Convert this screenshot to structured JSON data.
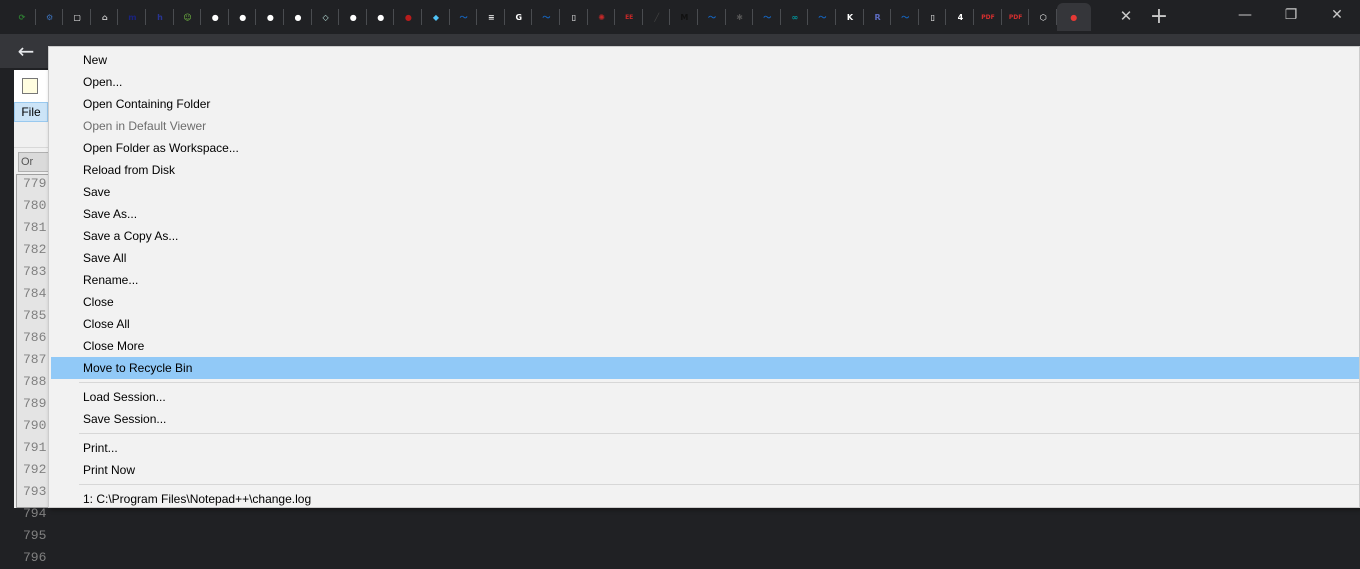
{
  "browser": {
    "tab_favicons": [
      {
        "icon": "globe-refresh-icon",
        "color": "#2e7d32",
        "glyph": "⟳"
      },
      {
        "icon": "python-script-icon",
        "color": "#3b6fb6",
        "glyph": "⚙"
      },
      {
        "icon": "window-square-icon",
        "color": "#ffffff",
        "glyph": "▢"
      },
      {
        "icon": "house-icon",
        "color": "#cfcfcf",
        "glyph": "⌂"
      },
      {
        "icon": "mathworks-icon",
        "color": "#1a237e",
        "glyph": "m"
      },
      {
        "icon": "h-letter-icon",
        "color": "#283593",
        "glyph": "h"
      },
      {
        "icon": "smiley-icon",
        "color": "#76c043",
        "glyph": "☺"
      },
      {
        "icon": "github-icon",
        "color": "#ffffff",
        "glyph": "●"
      },
      {
        "icon": "github-icon",
        "color": "#ffffff",
        "glyph": "●"
      },
      {
        "icon": "github-icon",
        "color": "#ffffff",
        "glyph": "●"
      },
      {
        "icon": "github-icon",
        "color": "#ffffff",
        "glyph": "●"
      },
      {
        "icon": "bulb-icon",
        "color": "#bfe6e0",
        "glyph": "◇"
      },
      {
        "icon": "github-icon",
        "color": "#ffffff",
        "glyph": "●"
      },
      {
        "icon": "github-icon",
        "color": "#ffffff",
        "glyph": "●"
      },
      {
        "icon": "bomb-icon",
        "color": "#b71c1c",
        "glyph": "●"
      },
      {
        "icon": "diagram-icon",
        "color": "#4fc3f7",
        "glyph": "◆"
      },
      {
        "icon": "feather-icon",
        "color": "#1565c0",
        "glyph": "〜"
      },
      {
        "icon": "script-icon",
        "color": "#e0e0e0",
        "glyph": "≡"
      },
      {
        "icon": "google-icon",
        "color": "#ffffff",
        "glyph": "G"
      },
      {
        "icon": "feather-icon",
        "color": "#1565c0",
        "glyph": "〜"
      },
      {
        "icon": "document-icon",
        "color": "#ffffff",
        "glyph": "▯"
      },
      {
        "icon": "compass-icon",
        "color": "#c62828",
        "glyph": "✺"
      },
      {
        "icon": "ee-459-icon",
        "color": "#c62828",
        "glyph": "EE"
      },
      {
        "icon": "chart-dark-icon",
        "color": "#444444",
        "glyph": "╱"
      },
      {
        "icon": "maker-icon",
        "color": "#111111",
        "glyph": "M"
      },
      {
        "icon": "feather-icon",
        "color": "#1565c0",
        "glyph": "〜"
      },
      {
        "icon": "bug-icon",
        "color": "#555555",
        "glyph": "✱"
      },
      {
        "icon": "feather-icon",
        "color": "#1565c0",
        "glyph": "〜"
      },
      {
        "icon": "arduino-icon",
        "color": "#00979d",
        "glyph": "∞"
      },
      {
        "icon": "feather-icon",
        "color": "#1565c0",
        "glyph": "〜"
      },
      {
        "icon": "k-letter-icon",
        "color": "#ffffff",
        "glyph": "K"
      },
      {
        "icon": "r-letter-icon",
        "color": "#5c6bc0",
        "glyph": "R"
      },
      {
        "icon": "feather-icon",
        "color": "#1565c0",
        "glyph": "〜"
      },
      {
        "icon": "document-icon",
        "color": "#ffffff",
        "glyph": "▯"
      },
      {
        "icon": "number-4-icon",
        "color": "#ffffff",
        "glyph": "4"
      },
      {
        "icon": "pdf-icon",
        "color": "#d32f2f",
        "glyph": "PDF"
      },
      {
        "icon": "pdf-icon",
        "color": "#d32f2f",
        "glyph": "PDF"
      },
      {
        "icon": "hexagon-icon",
        "color": "#ffffff",
        "glyph": "⬡"
      },
      {
        "icon": "record-icon",
        "color": "#e53935",
        "glyph": "●"
      }
    ],
    "close_tab_glyph": "✕",
    "new_tab_glyph": "+",
    "minimize_glyph": "—",
    "restore_glyph": "❐",
    "close_window_glyph": "✕",
    "back_glyph": "←"
  },
  "notepad": {
    "menu_file": "File",
    "doc_tab": "Or",
    "line_numbers": [
      "779",
      "780",
      "781",
      "782",
      "783",
      "784",
      "785",
      "786",
      "787",
      "788",
      "789",
      "790",
      "791",
      "792",
      "793",
      "794",
      "795",
      "796"
    ]
  },
  "file_menu": {
    "groups": [
      [
        {
          "label": "New",
          "enabled": true,
          "highlighted": false
        },
        {
          "label": "Open...",
          "enabled": true,
          "highlighted": false
        },
        {
          "label": "Open Containing Folder",
          "enabled": true,
          "highlighted": false
        },
        {
          "label": "Open in Default Viewer",
          "enabled": false,
          "highlighted": false
        },
        {
          "label": "Open Folder as Workspace...",
          "enabled": true,
          "highlighted": false
        },
        {
          "label": "Reload from Disk",
          "enabled": true,
          "highlighted": false
        },
        {
          "label": "Save",
          "enabled": true,
          "highlighted": false
        },
        {
          "label": "Save As...",
          "enabled": true,
          "highlighted": false
        },
        {
          "label": "Save a Copy As...",
          "enabled": true,
          "highlighted": false
        },
        {
          "label": "Save All",
          "enabled": true,
          "highlighted": false
        },
        {
          "label": "Rename...",
          "enabled": true,
          "highlighted": false
        },
        {
          "label": "Close",
          "enabled": true,
          "highlighted": false
        },
        {
          "label": "Close All",
          "enabled": true,
          "highlighted": false
        },
        {
          "label": "Close More",
          "enabled": true,
          "highlighted": false
        },
        {
          "label": "Move to Recycle Bin",
          "enabled": true,
          "highlighted": true
        }
      ],
      [
        {
          "label": "Load Session...",
          "enabled": true,
          "highlighted": false
        },
        {
          "label": "Save Session...",
          "enabled": true,
          "highlighted": false
        }
      ],
      [
        {
          "label": "Print...",
          "enabled": true,
          "highlighted": false
        },
        {
          "label": "Print Now",
          "enabled": true,
          "highlighted": false
        }
      ],
      [
        {
          "label": "1: C:\\Program Files\\Notepad++\\change.log",
          "enabled": true,
          "highlighted": false
        }
      ]
    ]
  }
}
